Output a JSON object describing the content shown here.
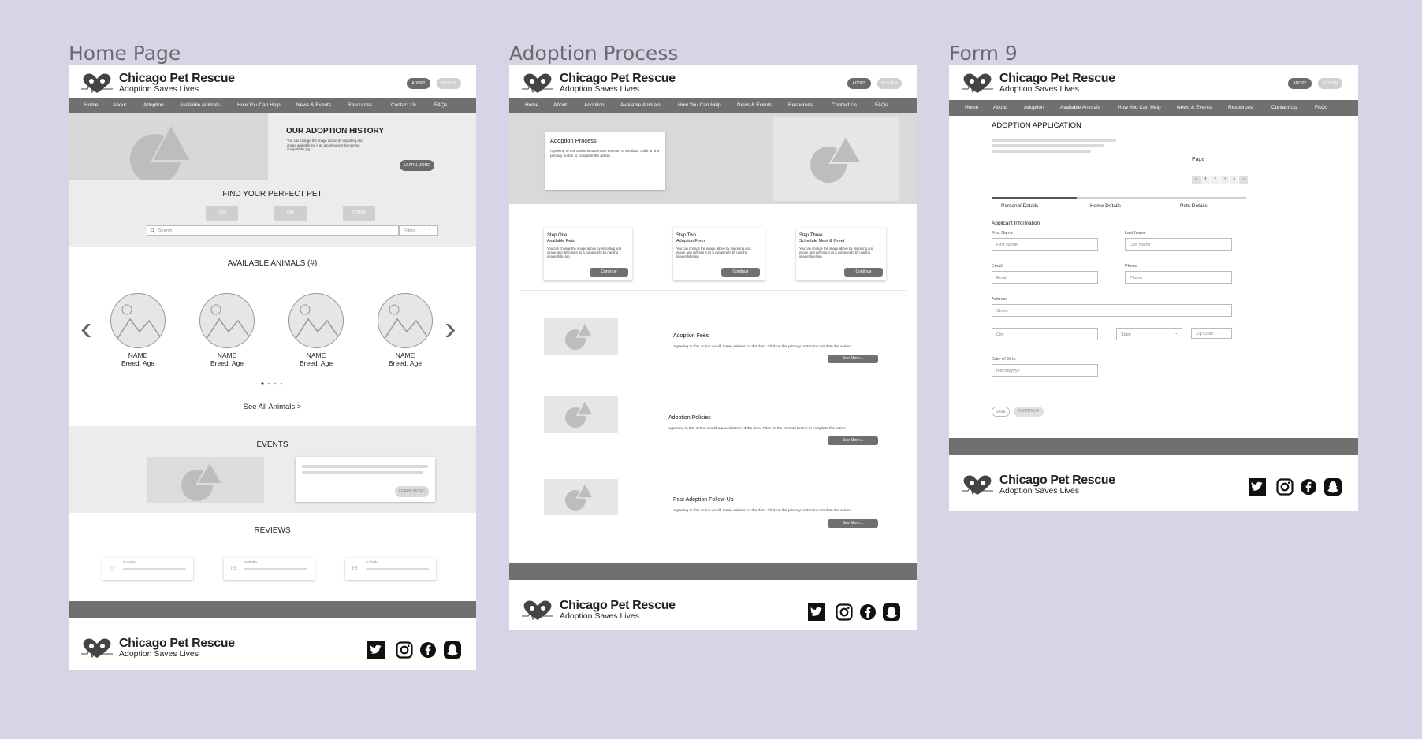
{
  "frames": {
    "home": "Home Page",
    "adoption": "Adoption Process",
    "form": "Form 9"
  },
  "brand": {
    "name": "Chicago Pet Rescue",
    "tagline": "Adoption Saves Lives",
    "adopt": "ADOPT",
    "foster": "FOSTER"
  },
  "nav": [
    "Home",
    "About",
    "Adoption",
    "Available Animals",
    "How You Can Help",
    "News & Events",
    "Resources",
    "Contact Us",
    "FAQs"
  ],
  "home": {
    "history_title": "OUR ADOPTION HISTORY",
    "history_text": "You can change the image above by importing and image and defining it as a component by naming imageSlider.jpg",
    "learn_more": "LEARN MORE",
    "find_title": "FIND YOUR PERFECT PET",
    "filters_btns": [
      "DOG",
      "CAT",
      "OTHER"
    ],
    "search_placeholder": "Search",
    "filters": "Filters",
    "available_title": "AVAILABLE ANIMALS (#)",
    "animals": [
      {
        "name": "NAME",
        "sub": "Breed, Age"
      },
      {
        "name": "NAME",
        "sub": "Breed, Age"
      },
      {
        "name": "NAME",
        "sub": "Breed, Age"
      },
      {
        "name": "NAME",
        "sub": "Breed, Age"
      }
    ],
    "see_all": "See All Animals >",
    "events_title": "EVENTS",
    "events_learn_more": "LEARN MORE",
    "reviews_title": "REVIEWS",
    "review_sub": "Subtitle"
  },
  "adoption": {
    "process_title": "Adoption Process",
    "process_text": "Agreeing to this action would mean deletion of the data. Click on the primary button to complete the action.",
    "steps": [
      {
        "title": "Step One",
        "sub": "Available Pets",
        "text": "You can change the image above by importing and image and defining it as a component by naming imageSlider.jpg",
        "btn": "Continue"
      },
      {
        "title": "Step Two",
        "sub": "Adoption Form",
        "text": "You can change the image above by importing and image and defining it as a component by naming imageSlider.jpg",
        "btn": "Continue"
      },
      {
        "title": "Step Three",
        "sub": "Schedule Meet & Greet",
        "text": "You can change the image above by importing and image and defining it as a component by naming imageSlider.jpg",
        "btn": "Continue"
      }
    ],
    "sections": [
      {
        "title": "Adoption Fees",
        "text": "Agreeing to this action would mean deletion of the data. Click on the primary button to complete the action.",
        "btn": "See More..."
      },
      {
        "title": "Adoption Policies",
        "text": "Agreeing to this action would mean deletion of the data. Click on the primary button to complete the action.",
        "btn": "See More..."
      },
      {
        "title": "Post Adoption Follow-Up",
        "text": "Agreeing to this action would mean deletion of the data. Click on the primary button to complete the action.",
        "btn": "See More..."
      }
    ]
  },
  "form": {
    "title": "ADOPTION APPLICATION",
    "page_label": "Page",
    "pages": [
      "<",
      "1",
      "2",
      "3",
      "4",
      ">"
    ],
    "tabs": [
      "Personal Details",
      "Home Details",
      "Pets Details"
    ],
    "section": "Applicant Information",
    "first_name_label": "First Name",
    "first_name_ph": "First Name",
    "last_name_label": "Last Name",
    "last_name_ph": "Last Name",
    "email_label": "Email",
    "email_ph": "Email",
    "phone_label": "Phone",
    "phone_ph": "Phone",
    "address_label": "Address",
    "street_ph": "Street",
    "city_ph": "City",
    "state_ph": "State",
    "zip_ph": "Zip Code",
    "dob_label": "Date of Birth",
    "dob_ph": "mm/dd/yyyy",
    "save": "SAVE",
    "continue": "CONTINUE"
  },
  "icons": [
    "heart-paw-logo-icon",
    "twitter-icon",
    "instagram-icon",
    "facebook-icon",
    "snapchat-icon",
    "search-icon",
    "chevron-left-icon",
    "chevron-right-icon",
    "caret-down-icon",
    "smiley-icon"
  ],
  "colors": {
    "background": "#d9d3e8",
    "nav": "#707070",
    "placeholder": "#e6e6e6"
  }
}
